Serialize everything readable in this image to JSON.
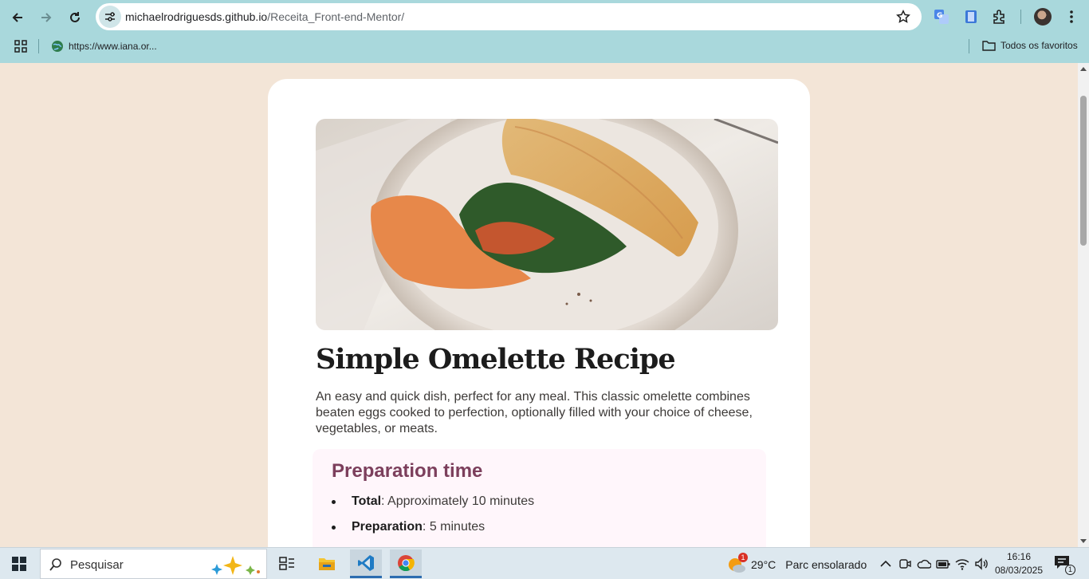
{
  "browser": {
    "url_host": "michaelrodriguesds.github.io",
    "url_path": "/Receita_Front-end-Mentor/",
    "bookmark_label": "https://www.iana.or...",
    "all_bookmarks_label": "Todos os favoritos"
  },
  "recipe": {
    "title": "Simple Omelette Recipe",
    "description": "An easy and quick dish, perfect for any meal. This classic omelette combines beaten eggs cooked to perfection, optionally filled with your choice of cheese, vegetables, or meats.",
    "preparation": {
      "heading": "Preparation time",
      "items": [
        {
          "label": "Total",
          "value": ": Approximately 10 minutes"
        },
        {
          "label": "Preparation",
          "value": ": 5 minutes"
        }
      ]
    }
  },
  "taskbar": {
    "search_placeholder": "Pesquisar",
    "weather_temp": "29°C",
    "weather_text": "Parc ensolarado",
    "weather_badge": "1",
    "time": "16:16",
    "date": "08/03/2025",
    "notification_count": "1"
  },
  "colors": {
    "page_bg": "#f3e5d7",
    "card_bg": "#ffffff",
    "prep_bg": "#fff6fb",
    "prep_heading": "#7c3f5c",
    "chrome_bg": "#a9d8dc"
  }
}
